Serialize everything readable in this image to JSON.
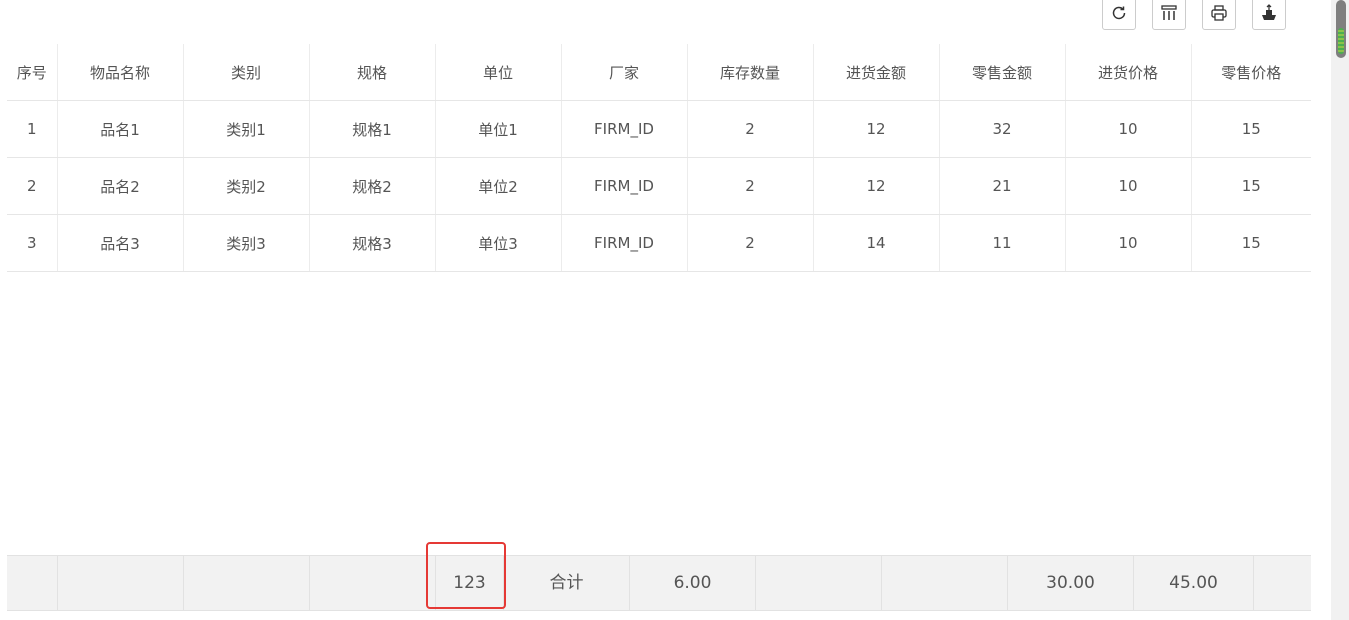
{
  "toolbar": {
    "icons": [
      "refresh-icon",
      "columns-icon",
      "print-icon",
      "export-icon"
    ]
  },
  "table": {
    "headers": [
      "序号",
      "物品名称",
      "类别",
      "规格",
      "单位",
      "厂家",
      "库存数量",
      "进货金额",
      "零售金额",
      "进货价格",
      "零售价格"
    ],
    "rows": [
      [
        "1",
        "品名1",
        "类别1",
        "规格1",
        "单位1",
        "FIRM_ID",
        "2",
        "12",
        "32",
        "10",
        "15"
      ],
      [
        "2",
        "品名2",
        "类别2",
        "规格2",
        "单位2",
        "FIRM_ID",
        "2",
        "12",
        "21",
        "10",
        "15"
      ],
      [
        "3",
        "品名3",
        "类别3",
        "规格3",
        "单位3",
        "FIRM_ID",
        "2",
        "14",
        "11",
        "10",
        "15"
      ]
    ]
  },
  "footer": {
    "cells": [
      "",
      "",
      "",
      "",
      "123",
      "合计",
      "6.00",
      "",
      "",
      "30.00",
      "45.00",
      ""
    ]
  },
  "colors": {
    "highlight": "#e53935",
    "footer_bg": "#f2f2f2"
  }
}
